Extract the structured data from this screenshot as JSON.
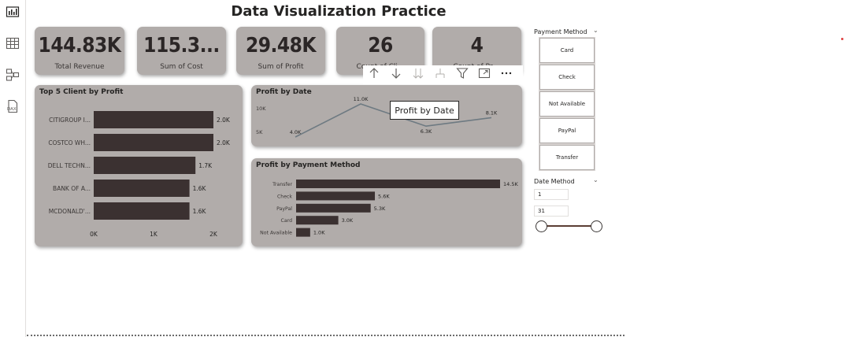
{
  "page": {
    "title": "Data Visualization Practice"
  },
  "rail": {
    "items": [
      {
        "name": "report-view",
        "icon": "bar-chart-icon"
      },
      {
        "name": "table-view",
        "icon": "table-grid-icon"
      },
      {
        "name": "model-view",
        "icon": "model-diagram-icon"
      },
      {
        "name": "dax-query-view",
        "icon": "dax-query-icon",
        "label": "DAX"
      }
    ]
  },
  "kpis": [
    {
      "value": "144.83K",
      "label": "Total Revenue"
    },
    {
      "value": "115.3...",
      "label": "Sum of Cost"
    },
    {
      "value": "29.48K",
      "label": "Sum of Profit"
    },
    {
      "value": "26",
      "label": "Count of Cli..."
    },
    {
      "value": "4",
      "label": "Count of Pa..."
    }
  ],
  "top_clients": {
    "title": "Top 5 Client by Profit"
  },
  "profit_by_date": {
    "title": "Profit by Date",
    "tooltip": "Profit by Date"
  },
  "profit_by_payment": {
    "title": "Profit by Payment Method"
  },
  "chart_data": [
    {
      "type": "bar",
      "orientation": "horizontal",
      "title": "Top 5 Client by Profit",
      "categories": [
        "CITIGROUP I...",
        "COSTCO WH...",
        "DELL TECHN...",
        "BANK OF A...",
        "MCDONALD'..."
      ],
      "values": [
        2.0,
        2.0,
        1.7,
        1.6,
        1.6
      ],
      "data_labels": [
        "2.0K",
        "2.0K",
        "1.7K",
        "1.6K",
        "1.6K"
      ],
      "xlim": [
        0,
        2
      ],
      "x_ticks": [
        "0K",
        "1K",
        "2K"
      ],
      "unit": "K"
    },
    {
      "type": "line",
      "title": "Profit by Date",
      "x": [
        1,
        2,
        3,
        4
      ],
      "values": [
        4.0,
        11.0,
        6.3,
        8.1
      ],
      "data_labels": [
        "4.0K",
        "11.0K",
        "6.3K",
        "8.1K"
      ],
      "y_ticks": [
        "10K",
        "5K"
      ],
      "ylim": [
        3,
        12
      ],
      "unit": "K"
    },
    {
      "type": "bar",
      "orientation": "horizontal",
      "title": "Profit by Payment Method",
      "categories": [
        "Transfer",
        "Check",
        "PayPal",
        "Card",
        "Not Available"
      ],
      "values": [
        14.5,
        5.6,
        5.3,
        3.0,
        1.0
      ],
      "data_labels": [
        "14.5K",
        "5.6K",
        "5.3K",
        "3.0K",
        "1.0K"
      ],
      "xlim": [
        0,
        14.5
      ],
      "unit": "K"
    }
  ],
  "visual_toolbar": {
    "buttons": [
      "arrow-up-icon",
      "arrow-down-icon",
      "double-arrow-down-icon",
      "expand-hierarchy-icon",
      "filter-icon",
      "focus-mode-icon",
      "more-options-icon"
    ]
  },
  "payment_slicer": {
    "header": "Payment Method",
    "options": [
      "Card",
      "Check",
      "Not Available",
      "PayPal",
      "Transfer"
    ]
  },
  "date_slicer": {
    "header": "Date Method",
    "start": "1",
    "end": "31"
  },
  "colors": {
    "card_bg": "#b1acaa",
    "bar": "#3b3131",
    "line": "#6e7a82",
    "slider": "#5b3e34"
  }
}
